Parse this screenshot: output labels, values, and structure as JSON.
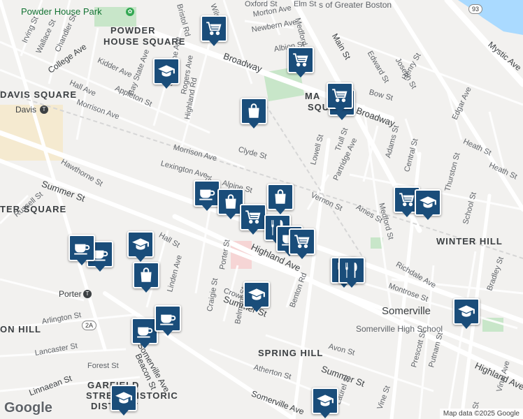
{
  "areas": [
    {
      "text": "POWDER"
    },
    {
      "text": "HOUSE SQUARE"
    },
    {
      "text": "DAVIS SQUARE"
    },
    {
      "text": "TER SQUARE"
    },
    {
      "text": "WINTER HILL"
    },
    {
      "text": "SPRING HILL"
    },
    {
      "text": "ON HILL"
    },
    {
      "text": "STREET HISTORIC"
    },
    {
      "text": "DISTRICT"
    },
    {
      "text": "MA"
    },
    {
      "text": "SQU"
    },
    {
      "text": "GARFIELD"
    }
  ],
  "pois": [
    {
      "text": "Powder House Park"
    },
    {
      "text": "Davis"
    },
    {
      "text": "Porter"
    },
    {
      "text": "Somerville"
    },
    {
      "text": "Somerville High School"
    },
    {
      "text": "s of Greater Boston"
    }
  ],
  "streets": [
    "Broadway",
    "Broadway",
    "College Ave",
    "Morrison Ave",
    "Morrison Ave",
    "Summer St",
    "Summer St",
    "Summer St",
    "Highland Ave",
    "Highland Ave",
    "Lexington Ave",
    "Alpine St",
    "Clyde St",
    "Medford St",
    "Medford St",
    "Main St",
    "Mystic Ave",
    "Lowell St",
    "Vernon St",
    "Central St",
    "Partridge Ave",
    "Trull St",
    "Adams St",
    "School St",
    "Thurston St",
    "Edgar Ave",
    "Heath St",
    "Heath St",
    "Bow St",
    "Bradley St",
    "Richdale Ave",
    "Montrose St",
    "Benton Rd",
    "Avon St",
    "Atherton St",
    "Somerville Ave",
    "Somerville Ave",
    "Belmont St",
    "Crown St",
    "Craigie St",
    "Porter St",
    "Hall St",
    "Linden Ave",
    "Russell St",
    "Hawthorne St",
    "Arlington St",
    "Lancaster St",
    "Forest St",
    "Linnaean St",
    "Beacon St",
    "Highland Rd",
    "Rogers Ave",
    "Josephine Ave",
    "Bay State Ave",
    "Kidder Ave",
    "Appleton St",
    "Hall Ave",
    "Irving St",
    "Wallace St",
    "Chandler St",
    "Morton Ave",
    "Newbern Ave",
    "Albion St",
    "Edward St",
    "Joseph St",
    "Henry St",
    "Ames St",
    "Prescott St",
    "Putnam St",
    "Vinal Ave",
    "Laurel St",
    "Vine St",
    "Wilson Ave",
    "Bristol Rd",
    "St",
    "St",
    "Oxford St",
    "Elm St"
  ],
  "routes": [
    "93",
    "2A"
  ],
  "markers": [
    {
      "icon": "shopping-cart-icon"
    },
    {
      "icon": "shopping-cart-icon"
    },
    {
      "icon": "shopping-cart-icon"
    },
    {
      "icon": "graduation-cap-icon"
    },
    {
      "icon": "shopping-bag-icon"
    },
    {
      "icon": "coffee-cup-icon"
    },
    {
      "icon": "shopping-bag-icon"
    },
    {
      "icon": "shopping-cart-icon"
    },
    {
      "icon": "restaurant-icon"
    },
    {
      "icon": "shopping-bag-icon"
    },
    {
      "icon": "coffee-cup-icon"
    },
    {
      "icon": "shopping-cart-icon"
    },
    {
      "icon": "restaurant-icon"
    },
    {
      "icon": "shopping-cart-icon"
    },
    {
      "icon": "graduation-cap-icon"
    },
    {
      "icon": "graduation-cap-icon"
    },
    {
      "icon": "coffee-cup-icon"
    },
    {
      "icon": "shopping-bag-icon"
    },
    {
      "icon": "graduation-cap-icon"
    },
    {
      "icon": "coffee-cup-icon"
    },
    {
      "icon": "coffee-cup-icon"
    },
    {
      "icon": "coffee-cup-icon"
    },
    {
      "icon": "graduation-cap-icon"
    },
    {
      "icon": "graduation-cap-icon"
    },
    {
      "icon": "graduation-cap-icon"
    },
    {
      "icon": "shopping-cart-icon"
    },
    {
      "icon": "restaurant-icon"
    }
  ],
  "branding": {
    "logo": "Google",
    "attribution": "Map data ©2025 Google"
  },
  "colors": {
    "marker": "#1a4d7a",
    "park": "#c8e6c9",
    "water": "#aadaff",
    "road": "#ffffff",
    "background": "#f2f1ef"
  }
}
